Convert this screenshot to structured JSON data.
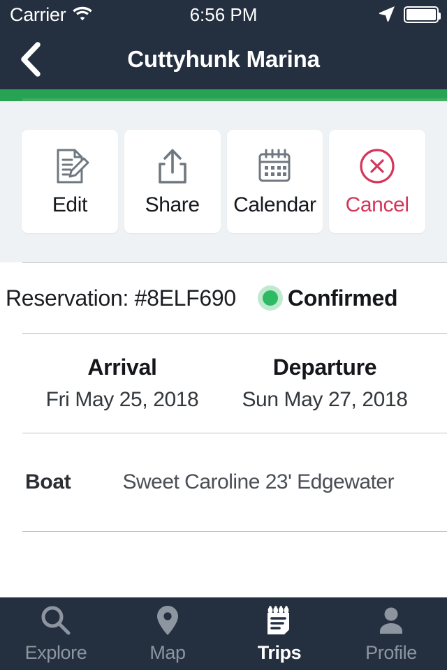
{
  "status_bar": {
    "carrier": "Carrier",
    "time": "6:56 PM",
    "wifi_icon": "wifi-icon",
    "location_icon": "location-arrow-icon",
    "battery_icon": "battery-full-icon"
  },
  "nav": {
    "back_icon": "chevron-left-icon",
    "title": "Cuttyhunk Marina"
  },
  "colors": {
    "nav_background": "#242f40",
    "accent_green": "#27a353",
    "status_green": "#2eb963",
    "danger_red": "#d6355a",
    "panel_background": "#eef2f5"
  },
  "actions": [
    {
      "label": "Edit",
      "icon": "document-edit-icon",
      "style": "default"
    },
    {
      "label": "Share",
      "icon": "share-upload-icon",
      "style": "default"
    },
    {
      "label": "Calendar",
      "icon": "calendar-icon",
      "style": "default"
    },
    {
      "label": "Cancel",
      "icon": "x-circle-icon",
      "style": "danger"
    }
  ],
  "reservation": {
    "label": "Reservation: #8ELF690",
    "status": "Confirmed",
    "status_dot": "status-dot-green"
  },
  "dates": {
    "arrival_title": "Arrival",
    "arrival_value": "Fri May 25, 2018",
    "departure_title": "Departure",
    "departure_value": "Sun May 27, 2018"
  },
  "boat": {
    "label": "Boat",
    "value": "Sweet Caroline 23' Edgewater"
  },
  "tabs": [
    {
      "label": "Explore",
      "icon": "search-icon",
      "active": false
    },
    {
      "label": "Map",
      "icon": "map-pin-icon",
      "active": false
    },
    {
      "label": "Trips",
      "icon": "notepad-icon",
      "active": true
    },
    {
      "label": "Profile",
      "icon": "person-icon",
      "active": false
    }
  ]
}
